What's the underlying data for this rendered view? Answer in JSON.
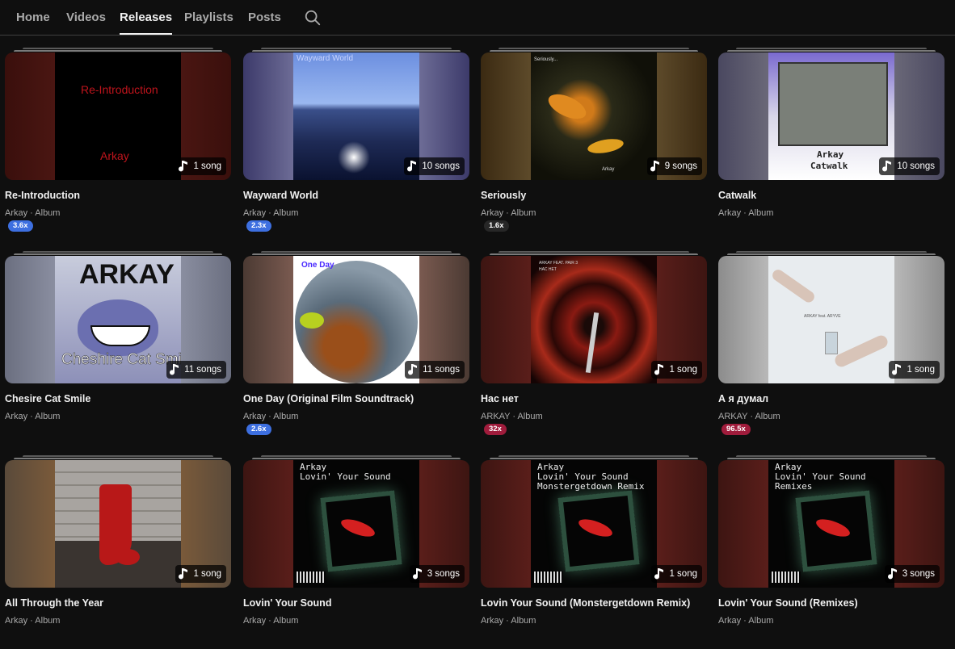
{
  "tabs": [
    {
      "label": "Home",
      "active": false
    },
    {
      "label": "Videos",
      "active": false
    },
    {
      "label": "Releases",
      "active": true
    },
    {
      "label": "Playlists",
      "active": false
    },
    {
      "label": "Posts",
      "active": false
    }
  ],
  "colors": {
    "blue_speed": "#3d6fe0",
    "dark_speed": "#272727",
    "red_speed": "#a01c3c"
  },
  "releases": [
    {
      "title": "Re-Introduction",
      "meta": "Arkay · Album",
      "songs": "1 song",
      "speed": "3.6x",
      "speed_color": "#3d6fe0",
      "art_text": [
        "Re-Introduction",
        "Arkay"
      ]
    },
    {
      "title": "Wayward World",
      "meta": "Arkay · Album",
      "songs": "10 songs",
      "speed": "2.3x",
      "speed_color": "#3d6fe0",
      "art_text": [
        "Wayward World"
      ]
    },
    {
      "title": "Seriously",
      "meta": "Arkay · Album",
      "songs": "9 songs",
      "speed": "1.6x",
      "speed_color": "#272727",
      "art_text": [
        "Seriously...",
        "Arkay"
      ]
    },
    {
      "title": "Catwalk",
      "meta": "Arkay · Album",
      "songs": "10 songs",
      "speed": "",
      "speed_color": "",
      "art_text": [
        "Arkay",
        "Catwalk"
      ]
    },
    {
      "title": "Chesire Cat Smile",
      "meta": "Arkay · Album",
      "songs": "11 songs",
      "speed": "",
      "speed_color": "",
      "art_text": [
        "ARKAY",
        "Cheshire Cat Smile"
      ]
    },
    {
      "title": "One Day (Original Film Soundtrack)",
      "meta": "Arkay · Album",
      "songs": "11 songs",
      "speed": "2.6x",
      "speed_color": "#3d6fe0",
      "art_text": [
        "One Day"
      ]
    },
    {
      "title": "Нас нет",
      "meta": "ARKAY · Album",
      "songs": "1 song",
      "speed": "32x",
      "speed_color": "#a01c3c",
      "art_text": [
        "ARKAY FEAT. PAIR 3",
        "НАС НЕТ"
      ]
    },
    {
      "title": "А я думал",
      "meta": "ARKAY · Album",
      "songs": "1 song",
      "speed": "96.5x",
      "speed_color": "#a01c3c",
      "art_text": [
        "ARKAY feat. ARYVE"
      ]
    },
    {
      "title": "All Through the Year",
      "meta": "Arkay · Album",
      "songs": "1 song",
      "speed": "",
      "speed_color": "",
      "art_text": []
    },
    {
      "title": "Lovin' Your Sound",
      "meta": "Arkay · Album",
      "songs": "3 songs",
      "speed": "",
      "speed_color": "",
      "art_text": [
        "Arkay",
        "Lovin' Your Sound"
      ]
    },
    {
      "title": "Lovin Your Sound (Monstergetdown Remix)",
      "meta": "Arkay · Album",
      "songs": "1 song",
      "speed": "",
      "speed_color": "",
      "art_text": [
        "Arkay",
        "Lovin' Your Sound",
        "Monstergetdown Remix"
      ]
    },
    {
      "title": "Lovin' Your Sound (Remixes)",
      "meta": "Arkay · Album",
      "songs": "3 songs",
      "speed": "",
      "speed_color": "",
      "art_text": [
        "Arkay",
        "Lovin' Your Sound",
        "Remixes"
      ]
    }
  ]
}
